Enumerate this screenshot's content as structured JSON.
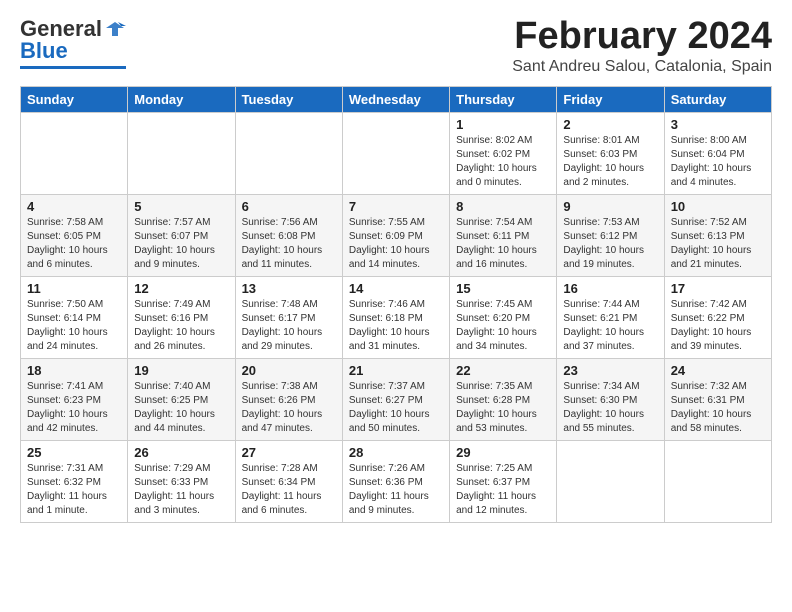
{
  "header": {
    "logo_general": "General",
    "logo_blue": "Blue",
    "month_title": "February 2024",
    "location": "Sant Andreu Salou, Catalonia, Spain"
  },
  "weekdays": [
    "Sunday",
    "Monday",
    "Tuesday",
    "Wednesday",
    "Thursday",
    "Friday",
    "Saturday"
  ],
  "weeks": [
    [
      {
        "day": "",
        "info": ""
      },
      {
        "day": "",
        "info": ""
      },
      {
        "day": "",
        "info": ""
      },
      {
        "day": "",
        "info": ""
      },
      {
        "day": "1",
        "info": "Sunrise: 8:02 AM\nSunset: 6:02 PM\nDaylight: 10 hours\nand 0 minutes."
      },
      {
        "day": "2",
        "info": "Sunrise: 8:01 AM\nSunset: 6:03 PM\nDaylight: 10 hours\nand 2 minutes."
      },
      {
        "day": "3",
        "info": "Sunrise: 8:00 AM\nSunset: 6:04 PM\nDaylight: 10 hours\nand 4 minutes."
      }
    ],
    [
      {
        "day": "4",
        "info": "Sunrise: 7:58 AM\nSunset: 6:05 PM\nDaylight: 10 hours\nand 6 minutes."
      },
      {
        "day": "5",
        "info": "Sunrise: 7:57 AM\nSunset: 6:07 PM\nDaylight: 10 hours\nand 9 minutes."
      },
      {
        "day": "6",
        "info": "Sunrise: 7:56 AM\nSunset: 6:08 PM\nDaylight: 10 hours\nand 11 minutes."
      },
      {
        "day": "7",
        "info": "Sunrise: 7:55 AM\nSunset: 6:09 PM\nDaylight: 10 hours\nand 14 minutes."
      },
      {
        "day": "8",
        "info": "Sunrise: 7:54 AM\nSunset: 6:11 PM\nDaylight: 10 hours\nand 16 minutes."
      },
      {
        "day": "9",
        "info": "Sunrise: 7:53 AM\nSunset: 6:12 PM\nDaylight: 10 hours\nand 19 minutes."
      },
      {
        "day": "10",
        "info": "Sunrise: 7:52 AM\nSunset: 6:13 PM\nDaylight: 10 hours\nand 21 minutes."
      }
    ],
    [
      {
        "day": "11",
        "info": "Sunrise: 7:50 AM\nSunset: 6:14 PM\nDaylight: 10 hours\nand 24 minutes."
      },
      {
        "day": "12",
        "info": "Sunrise: 7:49 AM\nSunset: 6:16 PM\nDaylight: 10 hours\nand 26 minutes."
      },
      {
        "day": "13",
        "info": "Sunrise: 7:48 AM\nSunset: 6:17 PM\nDaylight: 10 hours\nand 29 minutes."
      },
      {
        "day": "14",
        "info": "Sunrise: 7:46 AM\nSunset: 6:18 PM\nDaylight: 10 hours\nand 31 minutes."
      },
      {
        "day": "15",
        "info": "Sunrise: 7:45 AM\nSunset: 6:20 PM\nDaylight: 10 hours\nand 34 minutes."
      },
      {
        "day": "16",
        "info": "Sunrise: 7:44 AM\nSunset: 6:21 PM\nDaylight: 10 hours\nand 37 minutes."
      },
      {
        "day": "17",
        "info": "Sunrise: 7:42 AM\nSunset: 6:22 PM\nDaylight: 10 hours\nand 39 minutes."
      }
    ],
    [
      {
        "day": "18",
        "info": "Sunrise: 7:41 AM\nSunset: 6:23 PM\nDaylight: 10 hours\nand 42 minutes."
      },
      {
        "day": "19",
        "info": "Sunrise: 7:40 AM\nSunset: 6:25 PM\nDaylight: 10 hours\nand 44 minutes."
      },
      {
        "day": "20",
        "info": "Sunrise: 7:38 AM\nSunset: 6:26 PM\nDaylight: 10 hours\nand 47 minutes."
      },
      {
        "day": "21",
        "info": "Sunrise: 7:37 AM\nSunset: 6:27 PM\nDaylight: 10 hours\nand 50 minutes."
      },
      {
        "day": "22",
        "info": "Sunrise: 7:35 AM\nSunset: 6:28 PM\nDaylight: 10 hours\nand 53 minutes."
      },
      {
        "day": "23",
        "info": "Sunrise: 7:34 AM\nSunset: 6:30 PM\nDaylight: 10 hours\nand 55 minutes."
      },
      {
        "day": "24",
        "info": "Sunrise: 7:32 AM\nSunset: 6:31 PM\nDaylight: 10 hours\nand 58 minutes."
      }
    ],
    [
      {
        "day": "25",
        "info": "Sunrise: 7:31 AM\nSunset: 6:32 PM\nDaylight: 11 hours\nand 1 minute."
      },
      {
        "day": "26",
        "info": "Sunrise: 7:29 AM\nSunset: 6:33 PM\nDaylight: 11 hours\nand 3 minutes."
      },
      {
        "day": "27",
        "info": "Sunrise: 7:28 AM\nSunset: 6:34 PM\nDaylight: 11 hours\nand 6 minutes."
      },
      {
        "day": "28",
        "info": "Sunrise: 7:26 AM\nSunset: 6:36 PM\nDaylight: 11 hours\nand 9 minutes."
      },
      {
        "day": "29",
        "info": "Sunrise: 7:25 AM\nSunset: 6:37 PM\nDaylight: 11 hours\nand 12 minutes."
      },
      {
        "day": "",
        "info": ""
      },
      {
        "day": "",
        "info": ""
      }
    ]
  ]
}
